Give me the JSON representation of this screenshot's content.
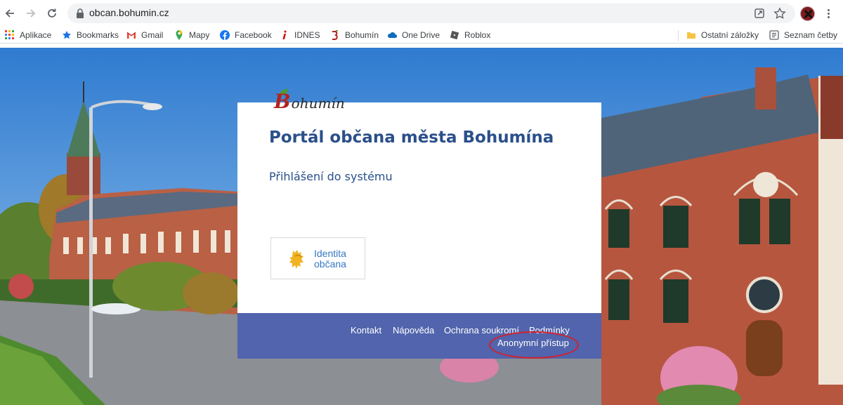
{
  "browser": {
    "url": "obcan.bohumin.cz",
    "bookmarks": [
      {
        "label": "Aplikace",
        "icon": "apps-grid-icon"
      },
      {
        "label": "Bookmarks",
        "icon": "star-icon"
      },
      {
        "label": "Gmail",
        "icon": "gmail-icon"
      },
      {
        "label": "Mapy",
        "icon": "maps-pin-icon"
      },
      {
        "label": "Facebook",
        "icon": "facebook-icon"
      },
      {
        "label": "IDNES",
        "icon": "idnes-icon"
      },
      {
        "label": "Bohumín",
        "icon": "bohumin-icon"
      },
      {
        "label": "One Drive",
        "icon": "onedrive-cloud-icon"
      },
      {
        "label": "Roblox",
        "icon": "roblox-icon"
      }
    ],
    "other_bookmarks": "Ostatní záložky",
    "reading_list": "Seznam četby"
  },
  "portal": {
    "logo_letter": "B",
    "logo_rest": "ohumín",
    "title": "Portál občana města Bohumína",
    "login_heading": "Přihlášení do systému",
    "identity_line1": "Identita",
    "identity_line2": "občana"
  },
  "footer": {
    "links": [
      "Kontakt",
      "Nápověda",
      "Ochrana soukromí",
      "Podmínky"
    ],
    "anonymous": "Anonymní přístup"
  },
  "colors": {
    "title": "#2a4f8a",
    "footer_bg": "#344aa0",
    "highlight_oval": "#d4202a",
    "identity_text": "#3577c3"
  }
}
